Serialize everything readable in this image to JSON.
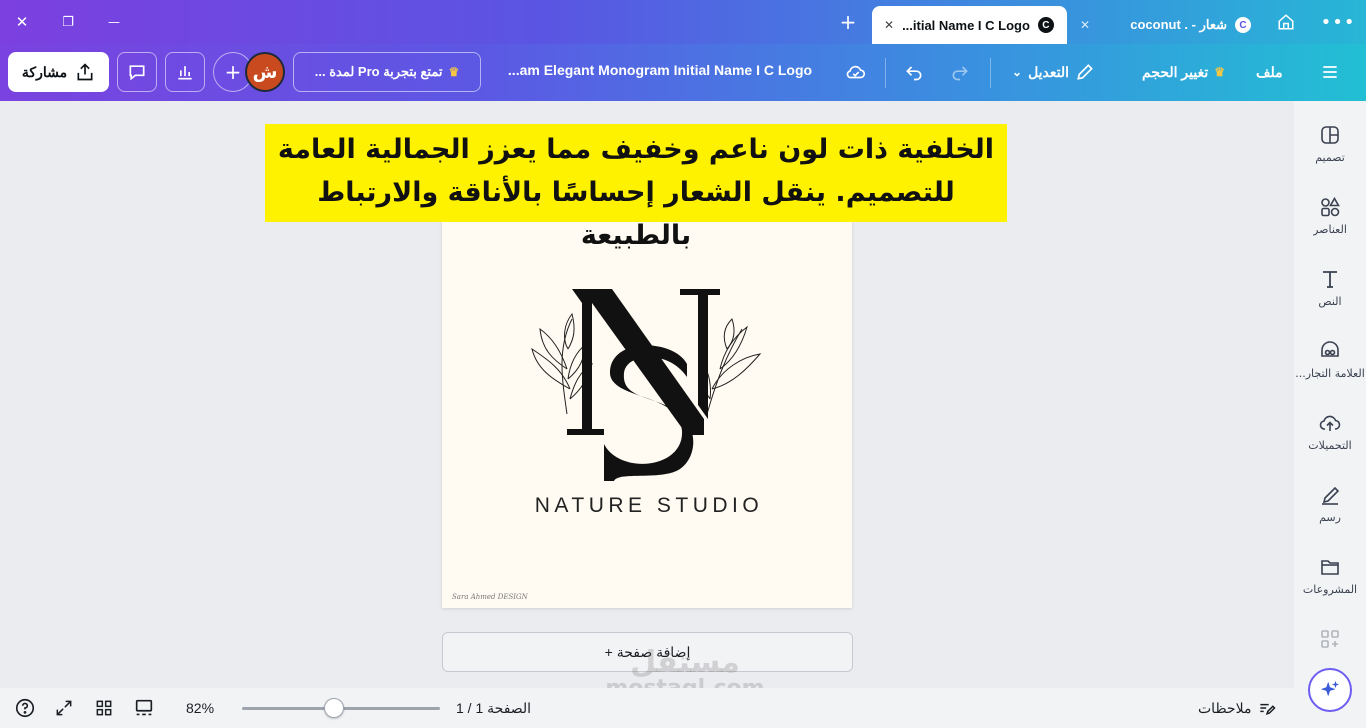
{
  "window": {
    "close": "✕",
    "restore": "❐",
    "minimize": "—"
  },
  "tabs": [
    {
      "title": "coconut . - شعار",
      "active": false
    },
    {
      "title": "...itial Name I C Logo",
      "active": true
    }
  ],
  "toolbar": {
    "menu_label": "ملف",
    "resize_label": "تغيير الحجم",
    "edit_label": "التعديل",
    "doc_title": "...am Elegant Monogram Initial Name I C Logo",
    "pro_label": "تمتع بتجربة Pro لمدة ...",
    "avatar_letter": "ش",
    "share_label": "مشاركة"
  },
  "caption": {
    "line1": "الخلفية ذات لون ناعم وخفيف مما يعزز الجمالية العامة",
    "line2": "للتصميم. ينقل الشعار إحساسًا بالأناقة والارتباط بالطبيعة"
  },
  "design": {
    "monogram": "NS",
    "brand_name": "NATURE STUDIO",
    "signature": "Sara Ahmed DESIGN"
  },
  "add_page_label": "+ إضافة صفحة",
  "sidebar": {
    "items": [
      {
        "label": "تصميم",
        "icon": "layout-icon"
      },
      {
        "label": "العناصر",
        "icon": "shapes-icon"
      },
      {
        "label": "النص",
        "icon": "text-icon"
      },
      {
        "label": "العلامة التجار...",
        "icon": "brand-icon"
      },
      {
        "label": "التحميلات",
        "icon": "upload-cloud-icon"
      },
      {
        "label": "رسم",
        "icon": "draw-icon"
      },
      {
        "label": "المشروعات",
        "icon": "folder-icon"
      }
    ]
  },
  "bottombar": {
    "notes_label": "ملاحظات",
    "page_indicator": "الصفحة 1 / 1",
    "zoom_percent": "82%",
    "zoom_level": 0.82
  },
  "watermark": {
    "ar": "مستقل",
    "en": "mostaql.com"
  },
  "colors": {
    "toolbar_gradient_start": "#7a42e0",
    "toolbar_gradient_end": "#22bfd4",
    "caption_highlight": "#fff200",
    "design_background": "#fffbf2",
    "avatar": "#c84a1e"
  }
}
